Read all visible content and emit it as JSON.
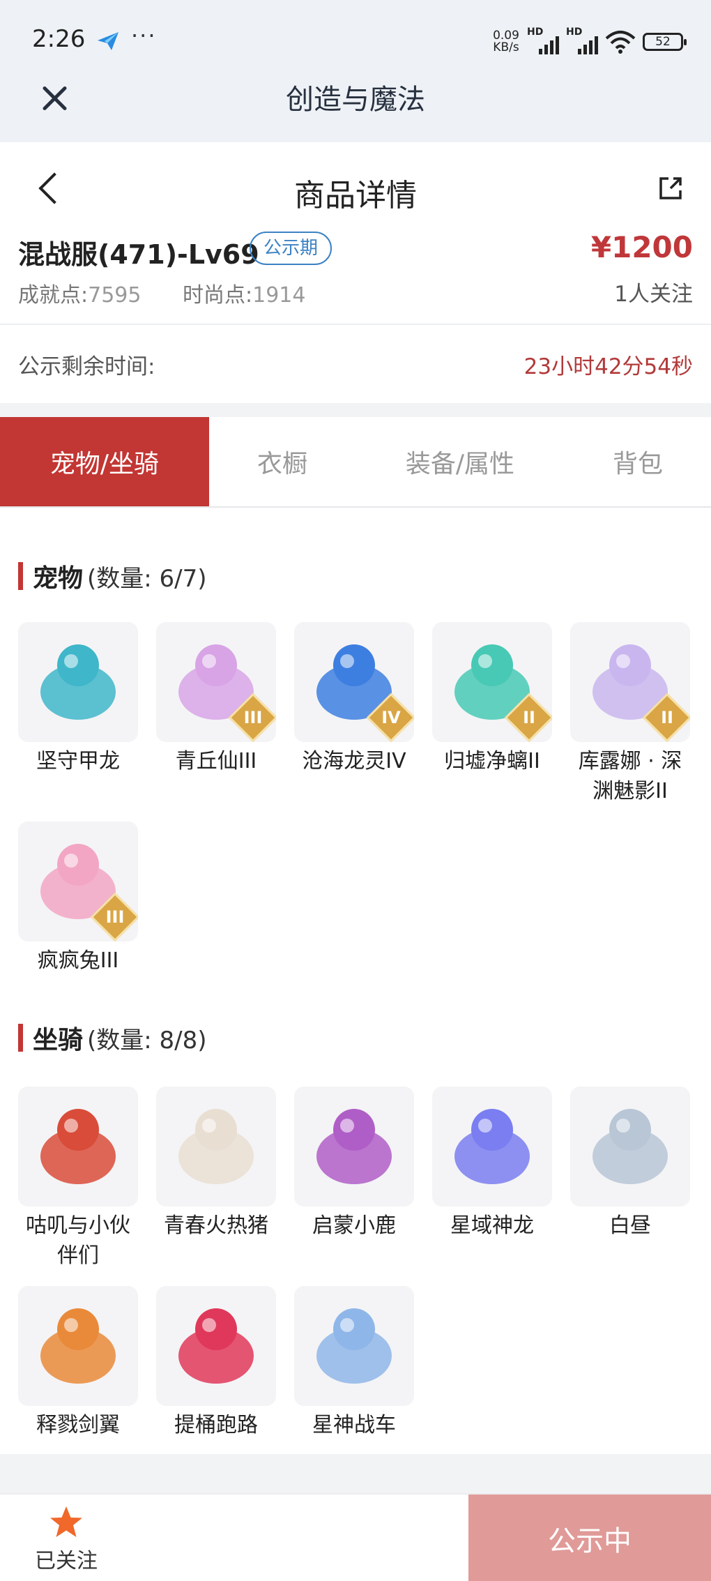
{
  "status_bar": {
    "time": "2:26",
    "net_speed_value": "0.09",
    "net_speed_unit": "KB/s",
    "signal_label": "HD",
    "battery": "52"
  },
  "app_bar": {
    "title": "创造与魔法"
  },
  "page_header": {
    "title": "商品详情"
  },
  "product": {
    "name": "混战服(471)-Lv69",
    "badge": "公示期",
    "price": "¥1200",
    "achievement_label": "成就点:",
    "achievement_value": "7595",
    "fashion_label": "时尚点:",
    "fashion_value": "1914",
    "watchers": "1人关注"
  },
  "timer": {
    "label": "公示剩余时间:",
    "value": "23小时42分54秒"
  },
  "tabs": [
    {
      "label": "宠物/坐骑",
      "active": true
    },
    {
      "label": "衣橱",
      "active": false
    },
    {
      "label": "装备/属性",
      "active": false
    },
    {
      "label": "背包",
      "active": false
    }
  ],
  "pets": {
    "title": "宠物",
    "count": "(数量: 6/7)",
    "items": [
      {
        "name": "坚守甲龙",
        "icon": "armored-dragon-icon",
        "color": "#3fb6c9",
        "tier": ""
      },
      {
        "name": "青丘仙III",
        "icon": "fox-fairy-icon",
        "color": "#d8a4e6",
        "tier": "III"
      },
      {
        "name": "沧海龙灵IV",
        "icon": "sea-dragon-spirit-icon",
        "color": "#3d7fe0",
        "tier": "IV"
      },
      {
        "name": "归墟净螭II",
        "icon": "jade-dragon-icon",
        "color": "#48c9b5",
        "tier": "II"
      },
      {
        "name": "库露娜 · 深渊魅影II",
        "icon": "abyss-phantom-icon",
        "color": "#c9b6ef",
        "tier": "II"
      },
      {
        "name": "疯疯兔III",
        "icon": "crazy-rabbit-icon",
        "color": "#f2a6c4",
        "tier": "III"
      }
    ]
  },
  "mounts": {
    "title": "坐骑",
    "count": "(数量: 8/8)",
    "items": [
      {
        "name": "咕叽与小伙伴们",
        "icon": "gooji-friends-icon",
        "color": "#d94c3a"
      },
      {
        "name": "青春火热猪",
        "icon": "pig-icon",
        "color": "#e9ded2"
      },
      {
        "name": "启蒙小鹿",
        "icon": "deer-icon",
        "color": "#b05ec7"
      },
      {
        "name": "星域神龙",
        "icon": "star-dragon-icon",
        "color": "#7a7ef0"
      },
      {
        "name": "白昼",
        "icon": "white-dragon-icon",
        "color": "#b9c6d6"
      },
      {
        "name": "释戮剑翼",
        "icon": "sword-wings-icon",
        "color": "#e98a3a"
      },
      {
        "name": "提桶跑路",
        "icon": "buckets-icon",
        "color": "#e0385a"
      },
      {
        "name": "星神战车",
        "icon": "star-horse-icon",
        "color": "#8fb6e8"
      }
    ]
  },
  "bottom": {
    "follow_label": "已关注",
    "status_button": "公示中"
  }
}
